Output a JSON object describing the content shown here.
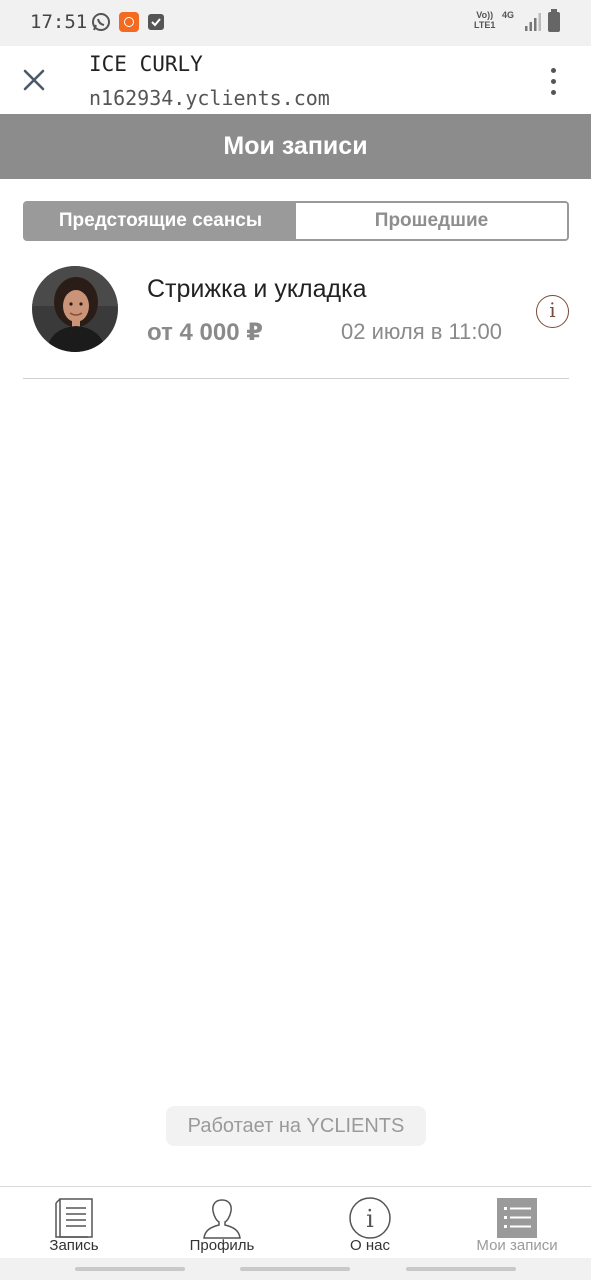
{
  "status_bar": {
    "time": "17:51",
    "network_top": "Vo))",
    "network_bottom": "LTE1",
    "network_type": "4G"
  },
  "header": {
    "title": "ICE CURLY",
    "url": "n162934.yclients.com"
  },
  "page": {
    "title": "Мои записи"
  },
  "tabs": [
    {
      "label": "Предстоящие сеансы",
      "active": true
    },
    {
      "label": "Прошедшие",
      "active": false
    }
  ],
  "appointments": [
    {
      "service": "Стрижка и укладка",
      "price": "от 4 000 ₽",
      "datetime": "02 июля в 11:00"
    }
  ],
  "footer": {
    "powered_by": "Работает на YCLIENTS"
  },
  "bottom_nav": [
    {
      "label": "Запись",
      "icon": "booking-icon",
      "active": false
    },
    {
      "label": "Профиль",
      "icon": "profile-icon",
      "active": false
    },
    {
      "label": "О нас",
      "icon": "info-icon",
      "active": false
    },
    {
      "label": "Мои записи",
      "icon": "my-records-icon",
      "active": true
    }
  ],
  "colors": {
    "title_bar": "#8c8c8c",
    "accent_gray": "#9a9a9a",
    "info_accent": "#7a4a3a",
    "notification_app": "#f26b21"
  }
}
